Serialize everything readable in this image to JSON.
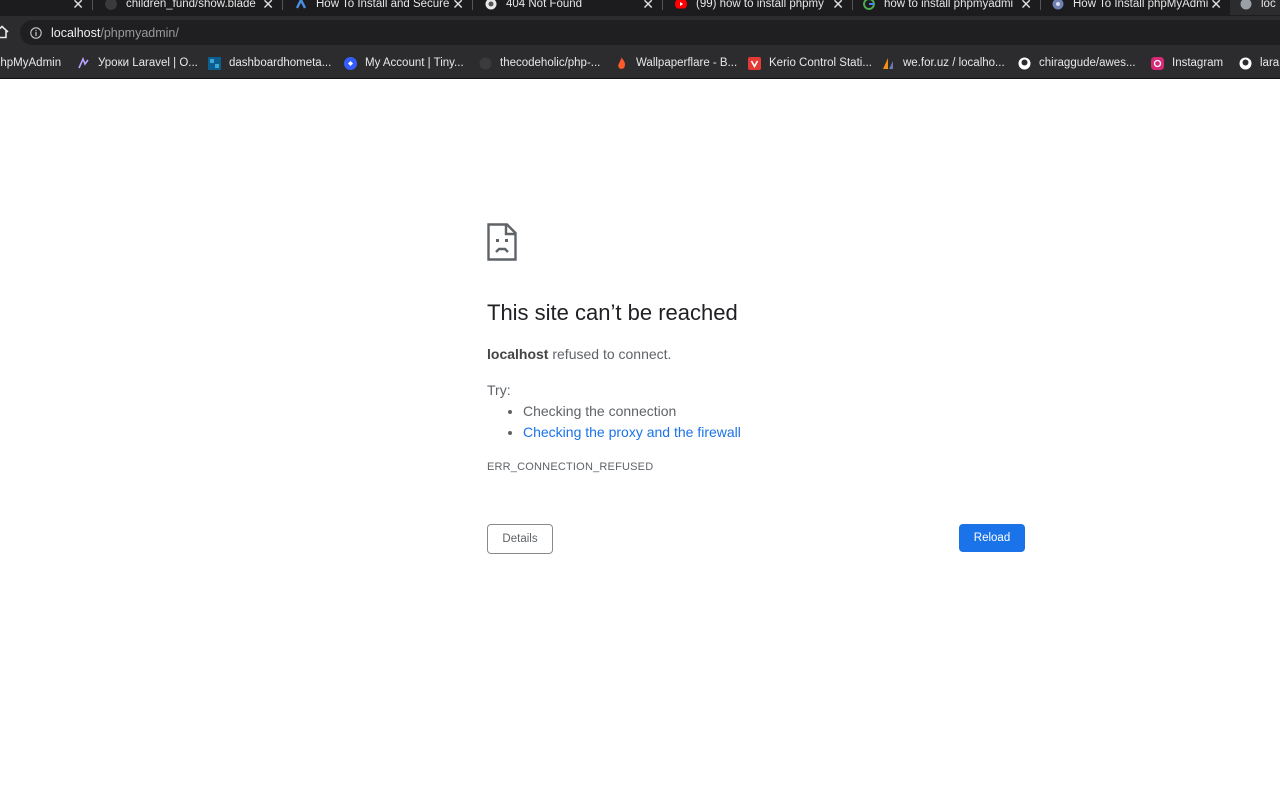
{
  "tabs": [
    {
      "title": "children_fund/show.blade",
      "icon": "github-icon",
      "active": false
    },
    {
      "title": "How To Install and Secure",
      "icon": "digitalocean-icon",
      "active": false
    },
    {
      "title": "404 Not Found",
      "icon": "globe-icon",
      "active": false
    },
    {
      "title": "(99) how to install phpmy",
      "icon": "youtube-icon",
      "active": false
    },
    {
      "title": "how to install phpmyadmi",
      "icon": "google-icon",
      "active": false
    },
    {
      "title": "How To Install phpMyAdmi",
      "icon": "globe-icon",
      "active": false
    },
    {
      "title": "loc",
      "icon": "globe-icon",
      "active": true
    }
  ],
  "address_bar": {
    "host": "localhost",
    "path": "/phpmyadmin/"
  },
  "bookmarks": [
    {
      "label": "phpMyAdmin",
      "icon": "phpmyadmin-icon"
    },
    {
      "label": "Уроки Laravel | O...",
      "icon": "laravel-icon"
    },
    {
      "label": "dashboardhometa...",
      "icon": "dashboard-icon"
    },
    {
      "label": "My Account | Tiny...",
      "icon": "tiny-icon"
    },
    {
      "label": "thecodeholic/php-...",
      "icon": "github-icon"
    },
    {
      "label": "Wallpaperflare - B...",
      "icon": "flame-icon"
    },
    {
      "label": "Kerio Control Stati...",
      "icon": "shield-icon"
    },
    {
      "label": "we.for.uz / localho...",
      "icon": "phpmyadmin-sail-icon"
    },
    {
      "label": "chiraggude/awes...",
      "icon": "github-icon"
    },
    {
      "label": "Instagram",
      "icon": "instagram-icon"
    },
    {
      "label": "lara",
      "icon": "github-icon"
    }
  ],
  "error": {
    "title": "This site can’t be reached",
    "host": "localhost",
    "message": " refused to connect.",
    "try_label": "Try:",
    "suggestions": [
      "Checking the connection",
      "Checking the proxy and the firewall"
    ],
    "code": "ERR_CONNECTION_REFUSED",
    "details_label": "Details",
    "reload_label": "Reload"
  },
  "colors": {
    "link": "#1a73e8",
    "reload_button": "#1a73e8",
    "chrome_dark": "#2c2c2e"
  }
}
